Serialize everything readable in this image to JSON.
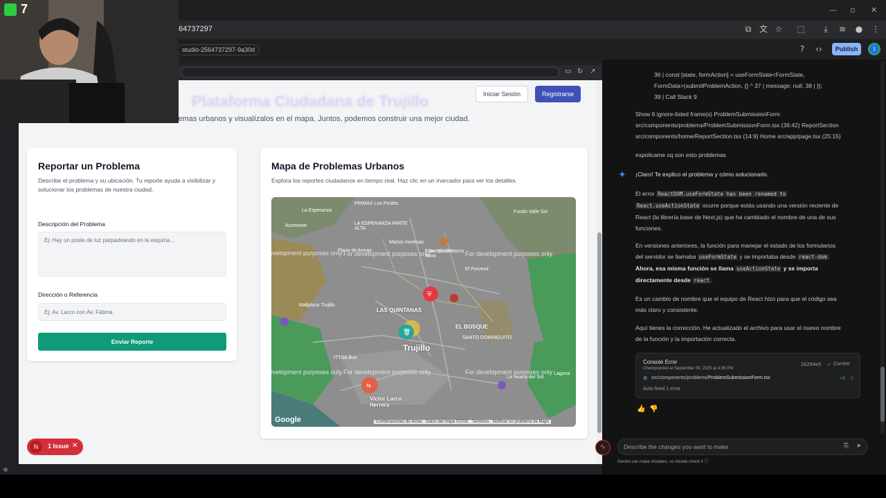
{
  "browser": {
    "url": "64737297",
    "studio_chip": "studio-2564737297-9a30d",
    "publish_label": "Publish",
    "avatar_initial": "I"
  },
  "webcam": {
    "counter": "7"
  },
  "app": {
    "header_title": "Plataforma Ciudadana de Trujillo",
    "login_label": "Iniciar Sesión",
    "register_label": "Registrarse",
    "subtitle": "lemas urbanos y visualízalos en el mapa. Juntos, podemos construir una mejor ciudad.",
    "report": {
      "title": "Reportar un Problema",
      "description": "Describe el problema y su ubicación. Tu reporte ayuda a visibilizar y solucionar los problemas de nuestra ciudad.",
      "desc_label": "Descripción del Problema",
      "desc_placeholder": "Ej: Hay un poste de luz parpadeando en la esquina...",
      "address_label": "Dirección o Referencia",
      "address_placeholder": "Ej: Av. Larco con Av. Fátima",
      "submit_label": "Enviar Reporte"
    },
    "map_card": {
      "title": "Mapa de Problemas Urbanos",
      "description": "Explora los reportes ciudadanos en tiempo real. Haz clic en un marcador para ver los detalles.",
      "dev_text": "For development purposes only",
      "labels": {
        "esperanza": "La Esperanza",
        "primax": "PRIMAX Los Postes",
        "fundo": "Fundo Valle Sol",
        "acomimar": "Acomimar",
        "esperanza_parte_alta": "LA ESPERANZA PARTE ALTA",
        "manos": "Manos morenas",
        "florencia": "Florencia de Mora",
        "plaza_armas": "Plaza de Armas",
        "av26": "Av. 26 de Marzo",
        "porvenir": "El Porvenir",
        "las_quintanas": "LAS QUINTANAS",
        "el_bosque": "EL BOSQUE",
        "santo_dominguito": "SANTO DOMINGUITO",
        "trujillo": "Trujillo",
        "mallplaza": "Mallplaza Trujillo",
        "ittsa": "ITTSA Bus",
        "victor_larco": "Víctor Larco Herrera",
        "huaca_sol": "La Huaca del Sol",
        "laguna": "Laguna"
      },
      "footer": {
        "shortcuts": "Combinaciones de teclas",
        "map_data": "Datos del mapa ©2025",
        "terms": "Términos",
        "report": "Notificar un problema de Maps"
      },
      "google": "Google"
    },
    "issues": {
      "n": "N",
      "label": "1 Issue"
    }
  },
  "chat": {
    "stack_lines": [
      "36 | const [state, formAction] = useFormState<FormState,",
      "FormData>(submitProblemAction, {} ^ 37 | message: null, 38 | });",
      "39 | Call Stack 9"
    ],
    "frames_line1": "Show 6 ignore-listed frame(s) ProblemSubmissionForm",
    "frames_line2": "src/components/problems/ProblemSubmissionForm.tsx (36:42) ReportSection",
    "frames_line3": "src/components/home/ReportSection.tsx (14:9) Home src/app/page.tsx (25:15)",
    "user_msg": "expolicame xq son esto problemas",
    "reply_intro": "¡Claro! Te explico el problema y cómo solucionarlo.",
    "p1_a": "El error",
    "p1_code1": "ReactDOM.useFormState has been renamed to",
    "p1_code2": "React.useActionState",
    "p1_b": "ocurre porque estás usando una versión reciente de",
    "p1_c": "React (la librería base de Next.js) que ha cambiado el nombre de una de sus",
    "p1_d": "funciones.",
    "p2_a": "En versiones anteriores, la función para manejar el estado de los formularios",
    "p2_b": "del servidor se llamaba",
    "p2_code1": "useFormState",
    "p2_c": "y se importaba desde",
    "p2_code2": "react-dom",
    "p2_d": "Ahora, esa misma función se llama",
    "p2_code3": "useActionState",
    "p2_e": "y se importa",
    "p2_f": "directamente desde",
    "p2_code4": "react",
    "p3_a": "Es un cambio de nombre que el equipo de React hizo para que el código sea",
    "p3_b": "más claro y consistente.",
    "p4_a": "Aquí tienes la corrección. He actualizado el archivo para usar el nuevo nombre",
    "p4_b": "de la función y la importación correcta.",
    "checkpoint": {
      "title": "Console Error",
      "subtitle": "Checkpointed at September 30, 2025 at 4:36 PM",
      "hash": "2b294e5",
      "current": "Current",
      "file_prefix": "src/components/problems/",
      "file_name": "ProblemSubmissionForm.tsx",
      "plus": "+3",
      "minus": "-2",
      "autofix": "Auto-fixed 1 error"
    },
    "input_placeholder": "Describe the changes you want to make",
    "disclaimer": "Gemini can make mistakes, so double-check it"
  },
  "colors": {
    "primary_green": "#0f9b7a",
    "register_blue": "#3f51b5",
    "issue_red": "#d32f3b",
    "publish_blue": "#8ab4f8"
  }
}
